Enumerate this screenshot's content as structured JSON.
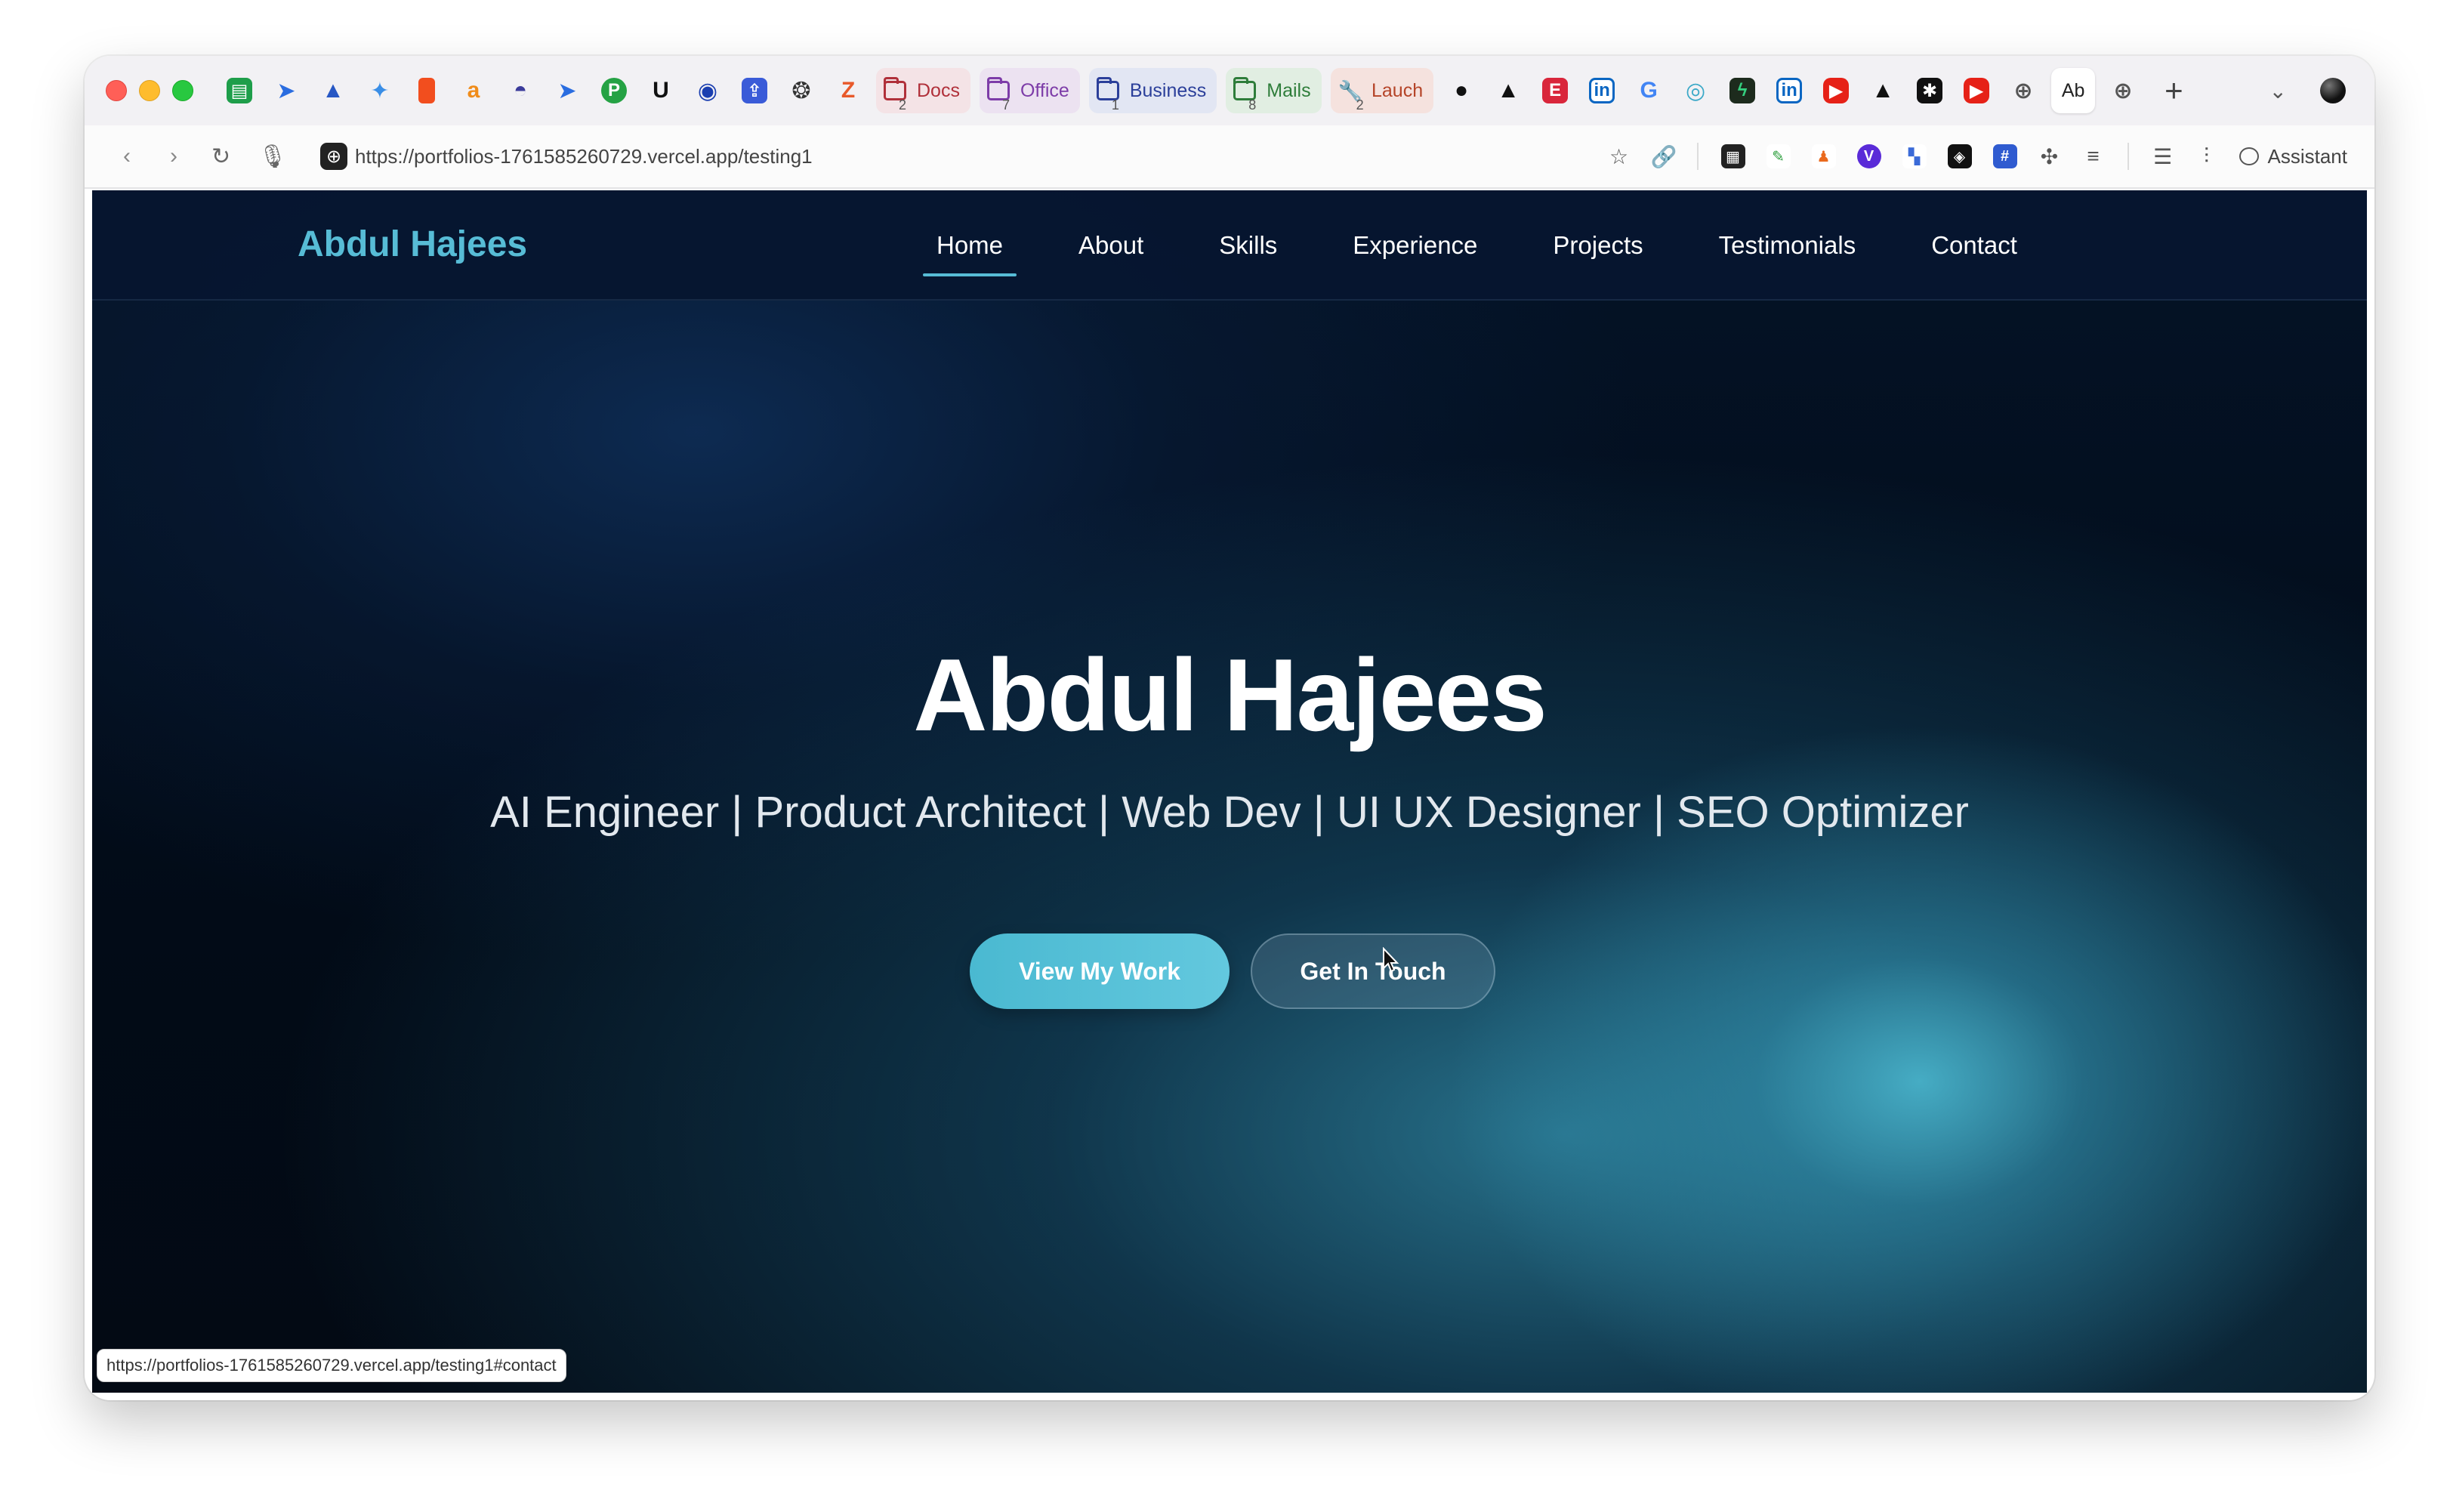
{
  "browser": {
    "tab_groups": [
      {
        "label": "Docs",
        "count": "2"
      },
      {
        "label": "Office",
        "count": "7"
      },
      {
        "label": "Business",
        "count": "1"
      },
      {
        "label": "Mails",
        "count": "8"
      },
      {
        "label": "Lauch",
        "count": "2"
      }
    ],
    "active_tab_label": "Ab",
    "new_tab": "+",
    "url": "https://portfolios-1761585260729.vercel.app/testing1",
    "assistant_label": "Assistant",
    "status_url": "https://portfolios-1761585260729.vercel.app/testing1#contact"
  },
  "site": {
    "brand": "Abdul Hajees",
    "nav": [
      "Home",
      "About",
      "Skills",
      "Experience",
      "Projects",
      "Testimonials",
      "Contact"
    ],
    "active_nav": "Home",
    "hero": {
      "title": "Abdul Hajees",
      "subtitle": "AI Engineer | Product Architect | Web Dev | UI UX Designer | SEO Optimizer",
      "primary_button": "View My Work",
      "secondary_button": "Get In Touch"
    }
  },
  "colors": {
    "accent": "#57bcd6",
    "nav_bg": "#06162f",
    "hero_glow": "#4ebed6"
  }
}
